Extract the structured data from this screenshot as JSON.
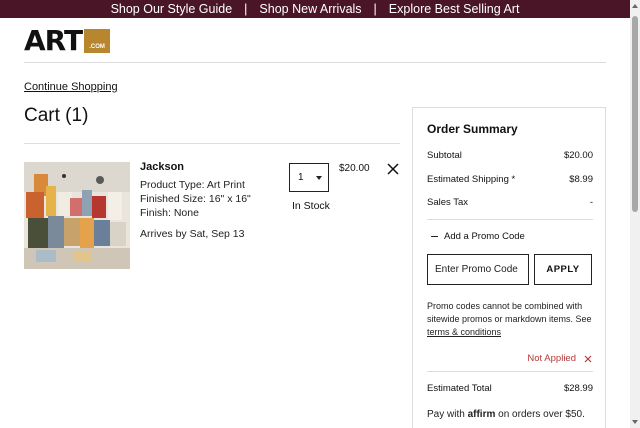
{
  "promo_bar": {
    "links": [
      "Shop Our Style Guide",
      "Shop New Arrivals",
      "Explore Best Selling Art"
    ],
    "separator": "|",
    "background": "#4a1526"
  },
  "logo": {
    "wordmark": "ART",
    "suffix": ".COM",
    "accent": "#b8862f"
  },
  "continue_shopping": "Continue Shopping",
  "cart": {
    "title": "Cart (1)",
    "item": {
      "name": "Jackson",
      "product_type": "Product Type: Art Print",
      "finished_size": "Finished Size: 16\" x 16\"",
      "finish": "Finish: None",
      "arrival": "Arrives by Sat, Sep 13",
      "quantity": "1",
      "stock": "In Stock",
      "price": "$20.00"
    }
  },
  "summary": {
    "title": "Order Summary",
    "subtotal_label": "Subtotal",
    "subtotal_value": "$20.00",
    "shipping_label": "Estimated Shipping *",
    "shipping_value": "$8.99",
    "tax_label": "Sales Tax",
    "tax_value": "-",
    "add_promo_label": "Add a Promo Code",
    "promo_placeholder": "Enter Promo Code",
    "apply_label": "APPLY",
    "promo_note": "Promo codes cannot be combined with sitewide promos or markdown items. See",
    "terms_link": "terms & conditions",
    "not_applied": "Not Applied",
    "not_applied_color": "#b33a3a",
    "total_label": "Estimated Total",
    "total_value": "$28.99",
    "pay_prefix": "Pay with",
    "pay_brand": "affirm",
    "pay_suffix": "on orders over $50."
  }
}
